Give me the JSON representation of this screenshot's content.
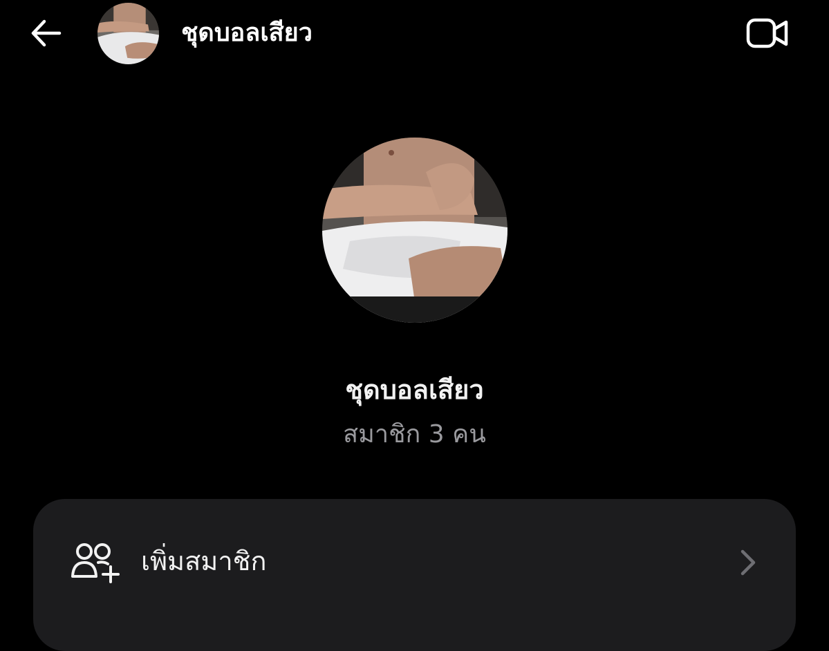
{
  "header": {
    "back_icon": "arrow-left-icon",
    "title": "ชุดบอลเสียว",
    "video_icon": "video-camera-icon"
  },
  "group": {
    "name": "ชุดบอลเสียว",
    "member_count": "สมาชิก 3 คน"
  },
  "actions": {
    "add_member_icon": "add-people-icon",
    "add_member_label": "เพิ่มสมาชิก",
    "chevron_icon": "chevron-right-icon"
  },
  "colors": {
    "background": "#000000",
    "card": "#1c1c1e",
    "primary_text": "#f2f2f2",
    "secondary_text": "#9a9a9e",
    "chevron": "#6e6e73"
  }
}
